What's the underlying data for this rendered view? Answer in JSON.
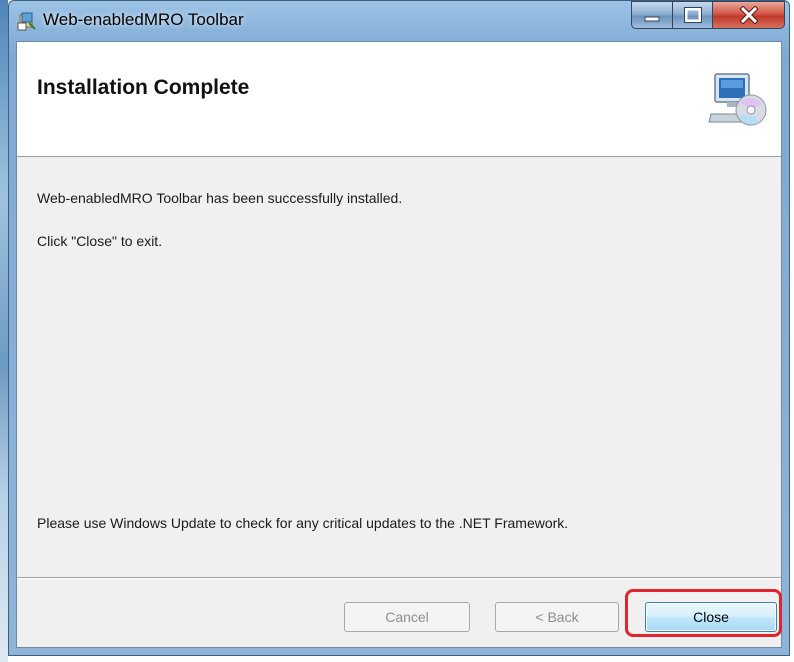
{
  "window": {
    "title": "Web-enabledMRO Toolbar",
    "icon": "installer-icon",
    "controls": {
      "minimize_icon": "minimize-icon",
      "maximize_icon": "maximize-icon",
      "close_icon": "close-icon"
    }
  },
  "banner": {
    "title": "Installation Complete",
    "icon": "computer-cd-icon"
  },
  "messages": {
    "success": "Web-enabledMRO Toolbar has been successfully installed.",
    "instruction": "Click \"Close\" to exit.",
    "update_note": "Please use Windows Update to check for any critical updates to the .NET Framework."
  },
  "buttons": {
    "cancel": "Cancel",
    "back": "< Back",
    "close": "Close"
  },
  "annotation": {
    "highlight_color": "#e0262b",
    "target": "Close"
  }
}
